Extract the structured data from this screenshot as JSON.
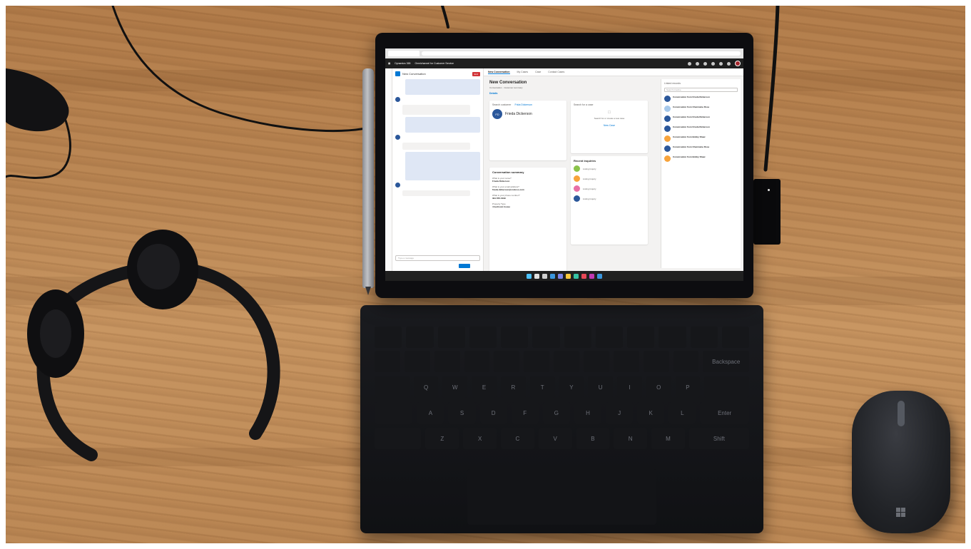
{
  "scene": {
    "colors": {
      "desk": "#b98552",
      "device": "#0d0d10",
      "screen_bg": "#f3f2f1",
      "accent": "#0078d4",
      "header": "#1f1f1f",
      "end_button": "#d13438"
    }
  },
  "app": {
    "brand": "Dynamics 365",
    "workspace_name": "Omnichannel for Customer Service",
    "tabs": [
      {
        "label": "New Conversation"
      },
      {
        "label": "My Cases"
      },
      {
        "label": "Case"
      },
      {
        "label": "Contact Cases"
      }
    ],
    "conversation": {
      "header_label": "New Conversation",
      "end_button": "End",
      "compose_placeholder": "Type a message"
    },
    "main": {
      "title": "New Conversation",
      "subtitle": "Conversation · Customer summary",
      "details_tab": "Details",
      "customer_card": {
        "header": "Search customer",
        "link": "Frida Dickerson",
        "initials": "FD",
        "name": "Frieda Dickerson"
      },
      "case_card": {
        "header": "Search for a case",
        "body": "Search for or create a new case",
        "link": "New Case"
      },
      "summary": {
        "title": "Conversation summary",
        "qa": [
          {
            "q": "What is your name?",
            "a": "Frieda Dickerson"
          },
          {
            "q": "What is your email address?",
            "a": "frieda.dickerson@contoso.com"
          },
          {
            "q": "What is your phone number?",
            "a": "391-555-0199"
          },
          {
            "q": "Property Type",
            "a": "4 bedroom house"
          }
        ]
      },
      "recent": {
        "title": "Recent inquiries",
        "items": [
          {
            "label": "Listing Inquiry",
            "color": "#8bc34a"
          },
          {
            "label": "Listing Inquiry",
            "color": "#f7a33b"
          },
          {
            "label": "Listing Inquiry",
            "color": "#e86fa6"
          },
          {
            "label": "Listing Inquiry",
            "color": "#2b579a"
          }
        ]
      },
      "feed": {
        "title": "Linked records",
        "search_placeholder": "Search timeline",
        "items": [
          {
            "title": "Conversation from Frieda Dickerson",
            "color": "#2b579a"
          },
          {
            "title": "Conversation from Charmaine Rose",
            "color": "#a6c8ea"
          },
          {
            "title": "Conversation from Frieda Dickerson",
            "color": "#2b579a"
          },
          {
            "title": "Conversation from Frieda Dickerson",
            "color": "#2b579a"
          },
          {
            "title": "Conversation from Bobby Shaw",
            "color": "#f7a33b"
          },
          {
            "title": "Conversation from Charmaine Rose",
            "color": "#2b579a"
          },
          {
            "title": "Conversation from Bobby Shaw",
            "color": "#f7a33b"
          }
        ]
      }
    },
    "taskbar_icons": [
      {
        "name": "windows-icon",
        "color": "#4cc2ff"
      },
      {
        "name": "search-icon",
        "color": "#e0e0e0"
      },
      {
        "name": "task-view-icon",
        "color": "#cfcfcf"
      },
      {
        "name": "widgets-icon",
        "color": "#3a96dd"
      },
      {
        "name": "teams-icon",
        "color": "#7b83eb"
      },
      {
        "name": "folder-icon",
        "color": "#ffc83d"
      },
      {
        "name": "edge-icon",
        "color": "#36c2a3"
      },
      {
        "name": "store-icon",
        "color": "#e74856"
      },
      {
        "name": "app-icon",
        "color": "#c239b3"
      },
      {
        "name": "settings-icon",
        "color": "#3a96dd"
      }
    ]
  },
  "keyboard": {
    "backspace": "Backspace",
    "enter": "Enter",
    "shift": "Shift",
    "row_q": [
      "Q",
      "W",
      "E",
      "R",
      "T",
      "Y",
      "U",
      "I",
      "O",
      "P"
    ],
    "row_a": [
      "A",
      "S",
      "D",
      "F",
      "G",
      "H",
      "J",
      "K",
      "L"
    ],
    "row_z": [
      "Z",
      "X",
      "C",
      "V",
      "B",
      "N",
      "M"
    ]
  }
}
